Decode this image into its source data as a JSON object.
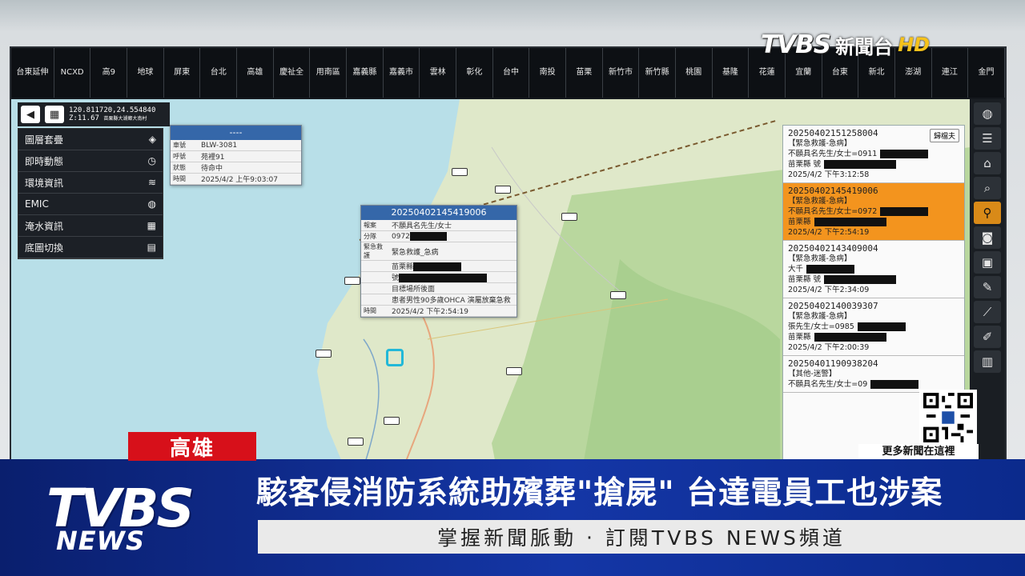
{
  "districts": [
    "台東延伸",
    "NCXD",
    "高9",
    "地球",
    "屏東",
    "台北",
    "高雄",
    "慶祉全",
    "用南區",
    "嘉義縣",
    "嘉義市",
    "雲林",
    "彰化",
    "台中",
    "南投",
    "苗栗",
    "新竹市",
    "新竹縣",
    "桃園",
    "基隆",
    "花蓮",
    "宜蘭",
    "台東",
    "新北",
    "澎湖",
    "連江",
    "金門"
  ],
  "map": {
    "coordinates": "120.811720,24.554840",
    "zoom": "Z:11.67",
    "address": "苗栗縣大湖鄉大南村",
    "left_menu": [
      {
        "label": "圖層套疊",
        "icon": "layers-icon"
      },
      {
        "label": "即時動態",
        "icon": "clock-icon"
      },
      {
        "label": "環境資訊",
        "icon": "wind-icon"
      },
      {
        "label": "EMIC",
        "icon": "globe-icon"
      },
      {
        "label": "淹水資訊",
        "icon": "grid-icon"
      },
      {
        "label": "底圖切換",
        "icon": "map-icon"
      }
    ],
    "vehicle_popup": {
      "title": "----",
      "rows": [
        {
          "k": "車號",
          "v": "BLW-3081"
        },
        {
          "k": "呼號",
          "v": "苑裡91"
        },
        {
          "k": "狀態",
          "v": "待命中"
        },
        {
          "k": "時間",
          "v": "2025/4/2 上午9:03:07"
        }
      ]
    },
    "case_popup": {
      "title": "20250402145419006",
      "rows": [
        {
          "k": "報案",
          "v": "不願具名先生/女士"
        },
        {
          "k": "分隊",
          "v": "0972"
        },
        {
          "k": "緊急救護",
          "v": "緊急救護_急病"
        },
        {
          "k": "",
          "v": "苗栗縣"
        },
        {
          "k": "",
          "v": "號"
        },
        {
          "k": "",
          "v": "目標場所後面"
        },
        {
          "k": "",
          "v": "患者男性90多歲OHCA 演屬放棄急救"
        },
        {
          "k": "時間",
          "v": "2025/4/2 下午2:54:19"
        }
      ]
    },
    "call_panel": {
      "archive_label": "歸檔夫",
      "calls": [
        {
          "id": "20250402151258004",
          "type": "【緊急救護-急病】",
          "caller": "不願具名先生/女士=0911",
          "place": "苗栗縣",
          "suffix": "號",
          "time": "2025/4/2 下午3:12:58",
          "selected": false
        },
        {
          "id": "20250402145419006",
          "type": "【緊急救護-急病】",
          "caller": "不願具名先生/女士=0972",
          "place": "苗栗縣",
          "suffix": "",
          "time": "2025/4/2 下午2:54:19",
          "selected": true
        },
        {
          "id": "20250402143409004",
          "type": "【緊急救護-急病】",
          "caller": "大千",
          "place": "苗栗縣",
          "suffix": "號",
          "time": "2025/4/2 下午2:34:09",
          "selected": false
        },
        {
          "id": "20250402140039307",
          "type": "【緊急救護-急病】",
          "caller": "張先生/女士=0985",
          "place": "苗栗縣",
          "suffix": "",
          "time": "2025/4/2 下午2:00:39",
          "selected": false
        },
        {
          "id": "20250401190938204",
          "type": "【其他-迷警】",
          "caller": "不願具名先生/女士=09",
          "place": "",
          "suffix": "",
          "time": "",
          "selected": false
        }
      ]
    }
  },
  "toolbar_icons": [
    "globe-icon",
    "list-icon",
    "home-icon",
    "zoom-icon",
    "pin-icon",
    "camera-icon",
    "image-icon",
    "edit-icon",
    "ruler-icon",
    "pen-icon",
    "book-icon"
  ],
  "overlay": {
    "channel_brand": "TVBS",
    "channel_name": "新聞台",
    "hd": "HD",
    "qr_note": "更多新聞在這裡",
    "location": "高雄",
    "headline": "駭客侵消防系統助殯葬\"搶屍\" 台達電員工也涉案",
    "ticker": "掌握新聞脈動 ‧ 訂閱TVBS NEWS頻道",
    "news_logo_big": "TVBS",
    "news_logo_small": "NEWS"
  },
  "colors": {
    "selected_call": "#f3941e",
    "popup_header": "#3567a9",
    "lower_third": "#1436a6",
    "location_tag": "#d7101a"
  }
}
